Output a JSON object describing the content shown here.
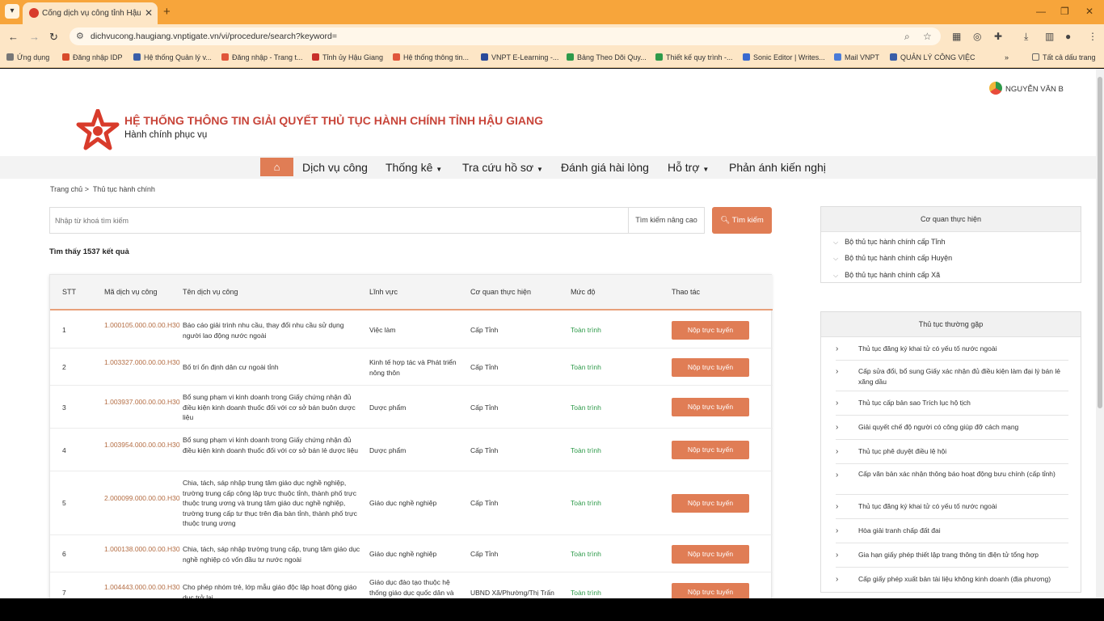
{
  "browser": {
    "tab_title": "Cổng dịch vụ công tỉnh Hậu Gi…",
    "url": "dichvucong.haugiang.vnptigate.vn/vi/procedure/search?keyword=",
    "bookmarks": [
      "Ứng dụng",
      "Đăng nhập IDP",
      "Hệ thống Quản lý v...",
      "Đăng nhập - Trang t...",
      "Tỉnh ủy Hậu Giang",
      "Hệ thống thông tin...",
      "VNPT E-Learning -...",
      "Bảng Theo Dõi Quy...",
      "Thiết kế quy trình -...",
      "Sonic Editor | Writes...",
      "Mail VNPT",
      "QUẢN LÝ CÔNG VIỆC"
    ],
    "all_bookmarks": "Tất cả dấu trang"
  },
  "header": {
    "user": "NGUYỄN VĂN B",
    "title": "HỆ THỐNG THÔNG TIN GIẢI QUYẾT THỦ TỤC HÀNH CHÍNH TỈNH HẬU GIANG",
    "subtitle": "Hành chính phục vụ"
  },
  "menu": [
    "Dịch vụ công",
    "Thống kê",
    "Tra cứu hồ sơ",
    "Đánh giá hài lòng",
    "Hỗ trợ",
    "Phản ánh kiến nghị"
  ],
  "breadcrumb": {
    "home": "Trang chủ",
    "current": "Thủ tục hành chính"
  },
  "search": {
    "placeholder": "Nhập từ khoá tìm kiếm",
    "advanced": "Tìm kiếm nâng cao",
    "button": "Tìm kiếm"
  },
  "found": "Tìm thấy 1537 kết quả",
  "table": {
    "headers": [
      "STT",
      "Mã dịch vụ công",
      "Tên dịch vụ công",
      "Lĩnh vực",
      "Cơ quan thực hiện",
      "Mức độ",
      "Thao tác"
    ],
    "button_label": "Nộp trực tuyến",
    "rows": [
      {
        "stt": "1",
        "code": "1.000105.000.00.00.H30",
        "name": "Báo cáo giải trình nhu cầu, thay đổi nhu cầu sử dụng người lao động nước ngoài",
        "field": "Việc làm",
        "agency": "Cấp Tỉnh",
        "level": "Toàn trình"
      },
      {
        "stt": "2",
        "code": "1.003327.000.00.00.H30",
        "name": "Bố trí ổn định dân cư ngoài tỉnh",
        "field": "Kinh tế hợp tác và Phát triển nông thôn",
        "agency": "Cấp Tỉnh",
        "level": "Toàn trình"
      },
      {
        "stt": "3",
        "code": "1.003937.000.00.00.H30",
        "name": "Bổ sung phạm vi kinh doanh trong Giấy chứng nhận đủ điều kiện kinh doanh thuốc đối với cơ sở bán buôn dược liệu",
        "field": "Dược phẩm",
        "agency": "Cấp Tỉnh",
        "level": "Toàn trình"
      },
      {
        "stt": "4",
        "code": "1.003954.000.00.00.H30",
        "name": "Bổ sung phạm vi kinh doanh trong Giấy chứng nhận đủ điều kiện kinh doanh thuốc đối với cơ sở bán lẻ dược liệu",
        "field": "Dược phẩm",
        "agency": "Cấp Tỉnh",
        "level": "Toàn trình"
      },
      {
        "stt": "5",
        "code": "2.000099.000.00.00.H30",
        "name": "Chia, tách, sáp nhập trung tâm giáo dục nghề nghiệp, trường trung cấp công lập trực thuộc tỉnh, thành phố trực thuộc trung ương và trung tâm giáo dục nghề nghiệp, trường trung cấp tư thục trên địa bàn tỉnh, thành phố trực thuộc trung ương",
        "field": "Giáo dục nghề nghiệp",
        "agency": "Cấp Tỉnh",
        "level": "Toàn trình"
      },
      {
        "stt": "6",
        "code": "1.000138.000.00.00.H30",
        "name": "Chia, tách, sáp nhập trường trung cấp, trung tâm giáo dục nghề nghiệp có vốn đầu tư nước ngoài",
        "field": "Giáo dục nghề nghiệp",
        "agency": "Cấp Tỉnh",
        "level": "Toàn trình"
      },
      {
        "stt": "7",
        "code": "1.004443.000.00.00.H30",
        "name": "Cho phép nhóm trẻ, lớp mẫu giáo độc lập hoạt động giáo dục trở lại",
        "field": "Giáo dục đào tạo thuộc hệ thống giáo dục quốc dân và",
        "agency": "UBND Xã/Phường/Thị Trấn",
        "level": "Toàn trình"
      }
    ]
  },
  "agency_panel": {
    "title": "Cơ quan thực hiện",
    "items": [
      "Bộ thủ tục hành chính cấp Tỉnh",
      "Bộ thủ tục hành chính cấp Huyện",
      "Bộ thủ tục hành chính cấp Xã"
    ]
  },
  "frequent_panel": {
    "title": "Thủ tục thường gặp",
    "items": [
      "Thủ tục đăng ký khai tử có yếu tố nước ngoài",
      "Cấp sửa đổi, bổ sung Giấy xác nhận đủ điều kiện làm đại lý bán lẻ xăng dầu",
      "Thủ tục cấp bản sao Trích lục hộ tịch",
      "Giải quyết chế độ người có công giúp đỡ cách mạng",
      "Thủ tục phê duyệt điều lệ hội",
      "Cấp văn bản xác nhận thông báo hoạt động bưu chính (cấp tỉnh)",
      "Thủ tục đăng ký khai tử có yếu tố nước ngoài",
      "Hòa giải tranh chấp đất đai",
      "Gia hạn giấy phép thiết lập trang thông tin điện tử tổng hợp",
      "Cấp giấy phép xuất bản tài liệu không kinh doanh (địa phương)"
    ]
  },
  "colors": {
    "accent": "#e07d55",
    "title_red": "#c8453a",
    "code": "#b46d43",
    "level_green": "#2e9a4a",
    "tabbar": "#f7a53b"
  }
}
